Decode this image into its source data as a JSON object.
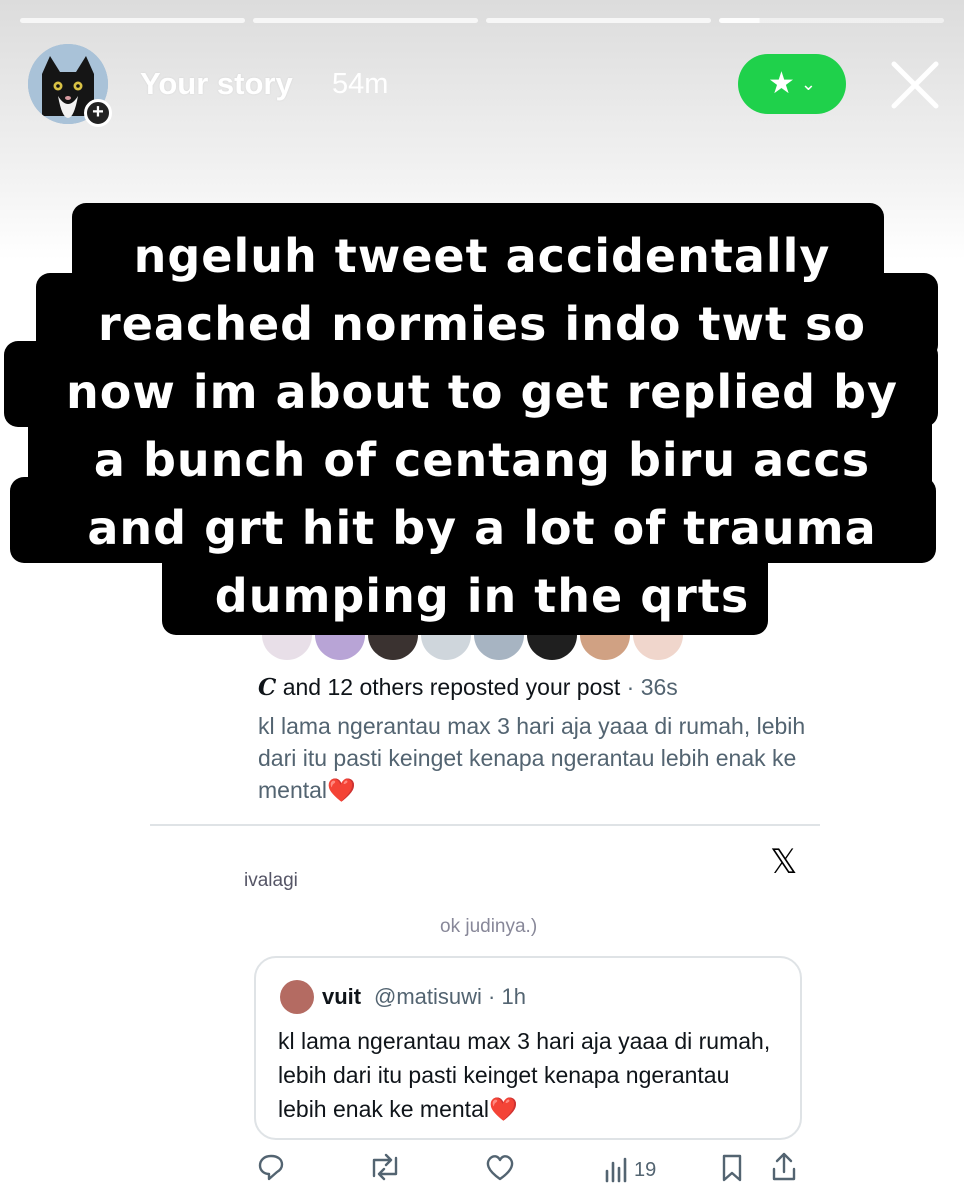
{
  "story": {
    "title": "Your story",
    "time": "54m",
    "progress_segments": 4,
    "progress_current": 4
  },
  "caption": {
    "lines": [
      "ngeluh tweet accidentally",
      "reached normies indo twt so",
      "now im about to get replied by",
      "a bunch of centang biru accs",
      "and grt hit by a lot of trauma",
      "dumping in the qrts"
    ]
  },
  "tweet": {
    "repost_glyph": "C",
    "repost_text": " and 12 others reposted your post",
    "repost_time": " · 36s",
    "original_text": "kl lama ngerantau max 3 hari aja yaaa di rumah, lebih dari itu pasti keinget kenapa ngerantau lebih enak ke mental",
    "original_emoji": "❤️",
    "obscured_name": "ivalagi",
    "obscured_text": "ok judinya.)",
    "quoted": {
      "name": "vuit",
      "handle": "@matisuwi · 1h",
      "text": "kl lama ngerantau max 3 hari aja yaaa di rumah, lebih dari itu pasti keinget kenapa ngerantau lebih enak ke mental",
      "emoji": "❤️"
    },
    "views": "19"
  },
  "colors": {
    "close_friends_green": "#1fd14b",
    "caption_bg": "#000000",
    "secondary_text": "#536471"
  },
  "icons": {
    "close_friends": "star-icon",
    "close": "close-icon",
    "reply": "reply-icon",
    "repost": "repost-icon",
    "like": "heart-icon",
    "views": "views-icon",
    "bookmark": "bookmark-icon",
    "share": "share-icon"
  }
}
